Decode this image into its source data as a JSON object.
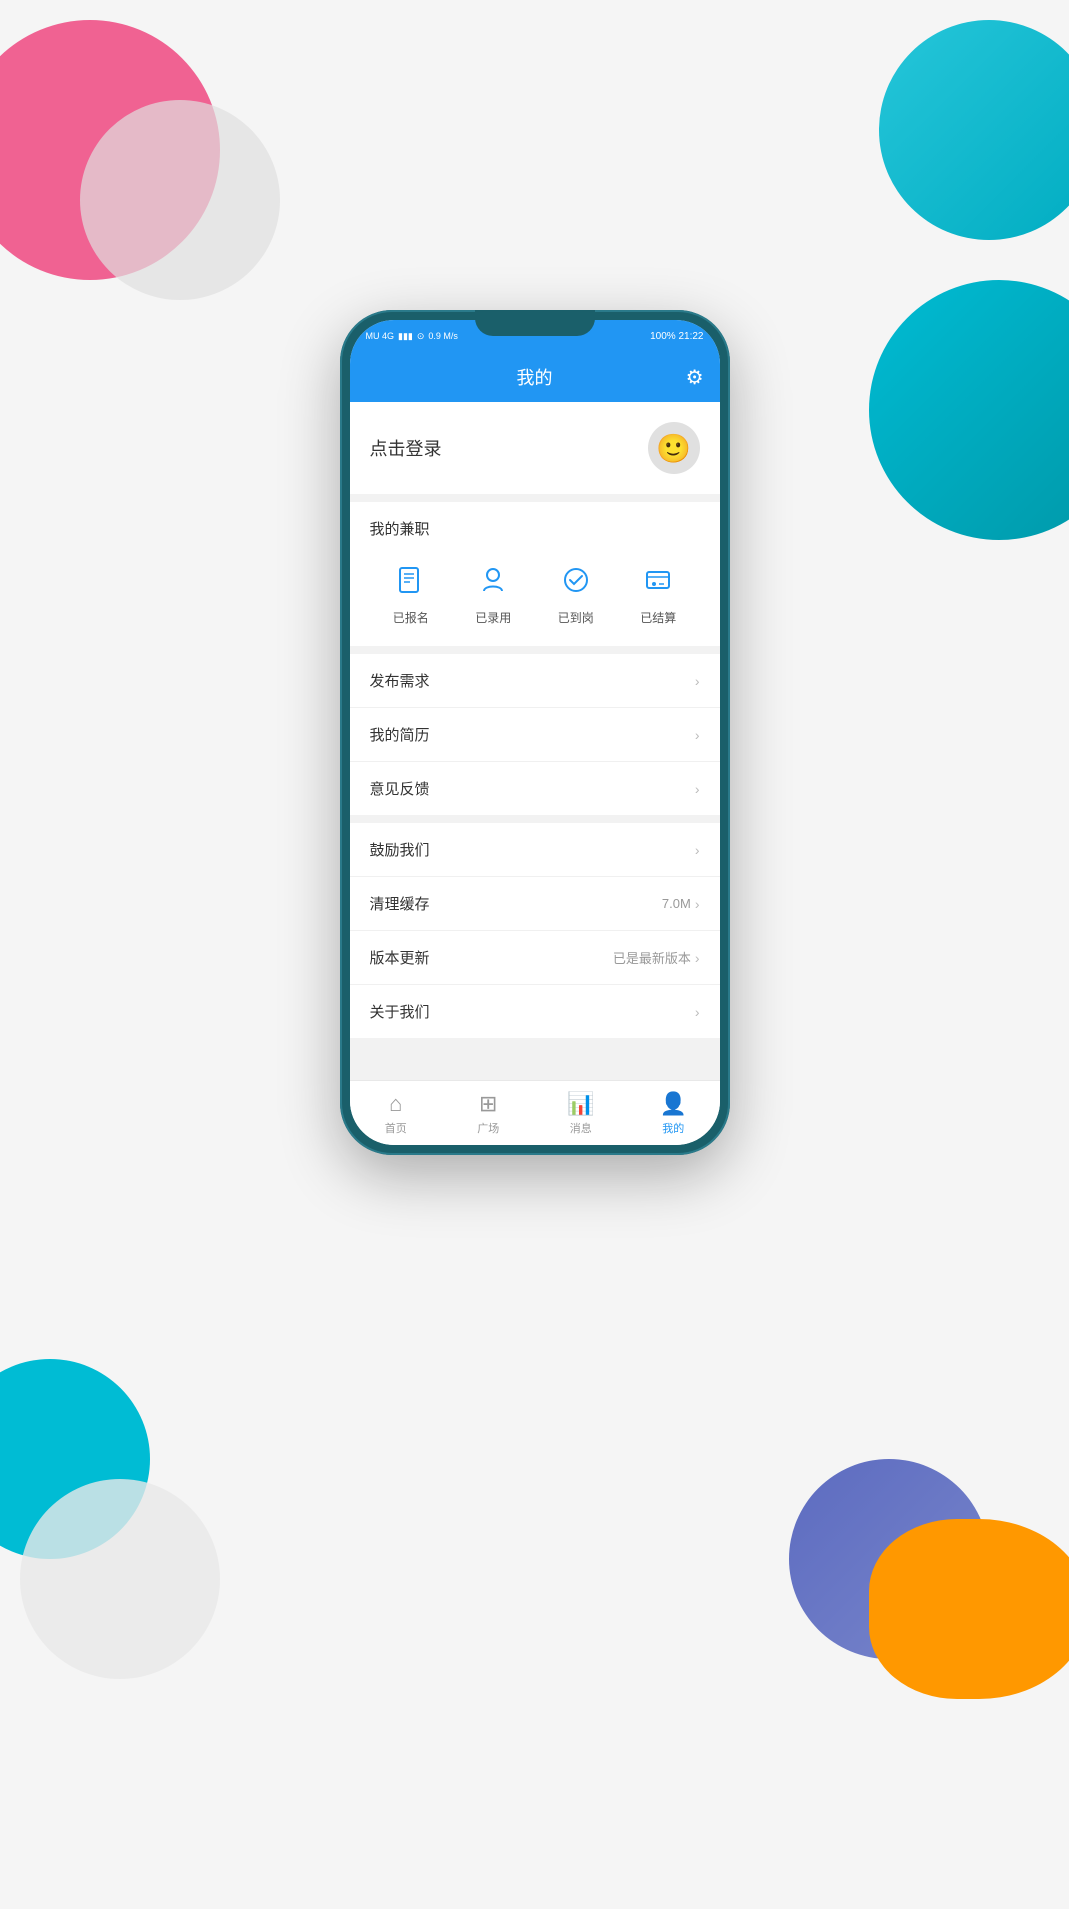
{
  "background": {
    "circles": [
      {
        "class": "bg-pink"
      },
      {
        "class": "bg-gray-light"
      },
      {
        "class": "bg-teal-top"
      },
      {
        "class": "bg-teal-bottom-right-large"
      },
      {
        "class": "bg-cyan-bottom-left"
      },
      {
        "class": "bg-gray-bottom-left"
      },
      {
        "class": "bg-blue-bottom-right"
      },
      {
        "class": "bg-orange-bottom-right"
      }
    ]
  },
  "statusBar": {
    "left": "MU 4G",
    "speed": "0.9 M/s",
    "right": "100% 21:22"
  },
  "header": {
    "title": "我的",
    "gear_label": "设置"
  },
  "login": {
    "text": "点击登录"
  },
  "parttime": {
    "section_title": "我的兼职",
    "items": [
      {
        "label": "已报名"
      },
      {
        "label": "已录用"
      },
      {
        "label": "已到岗"
      },
      {
        "label": "已结算"
      }
    ]
  },
  "menu": {
    "items": [
      {
        "text": "发布需求",
        "right_text": "",
        "show_chevron": true
      },
      {
        "text": "我的简历",
        "right_text": "",
        "show_chevron": true
      },
      {
        "text": "意见反馈",
        "right_text": "",
        "show_chevron": true
      },
      {
        "text": "鼓励我们",
        "right_text": "",
        "show_chevron": true
      },
      {
        "text": "清理缓存",
        "right_text": "7.0M",
        "show_chevron": true
      },
      {
        "text": "版本更新",
        "right_text": "已是最新版本",
        "show_chevron": true
      },
      {
        "text": "关于我们",
        "right_text": "",
        "show_chevron": true
      }
    ]
  },
  "bottomNav": {
    "items": [
      {
        "label": "首页",
        "active": false
      },
      {
        "label": "广场",
        "active": false
      },
      {
        "label": "消息",
        "active": false
      },
      {
        "label": "我的",
        "active": true
      }
    ]
  }
}
